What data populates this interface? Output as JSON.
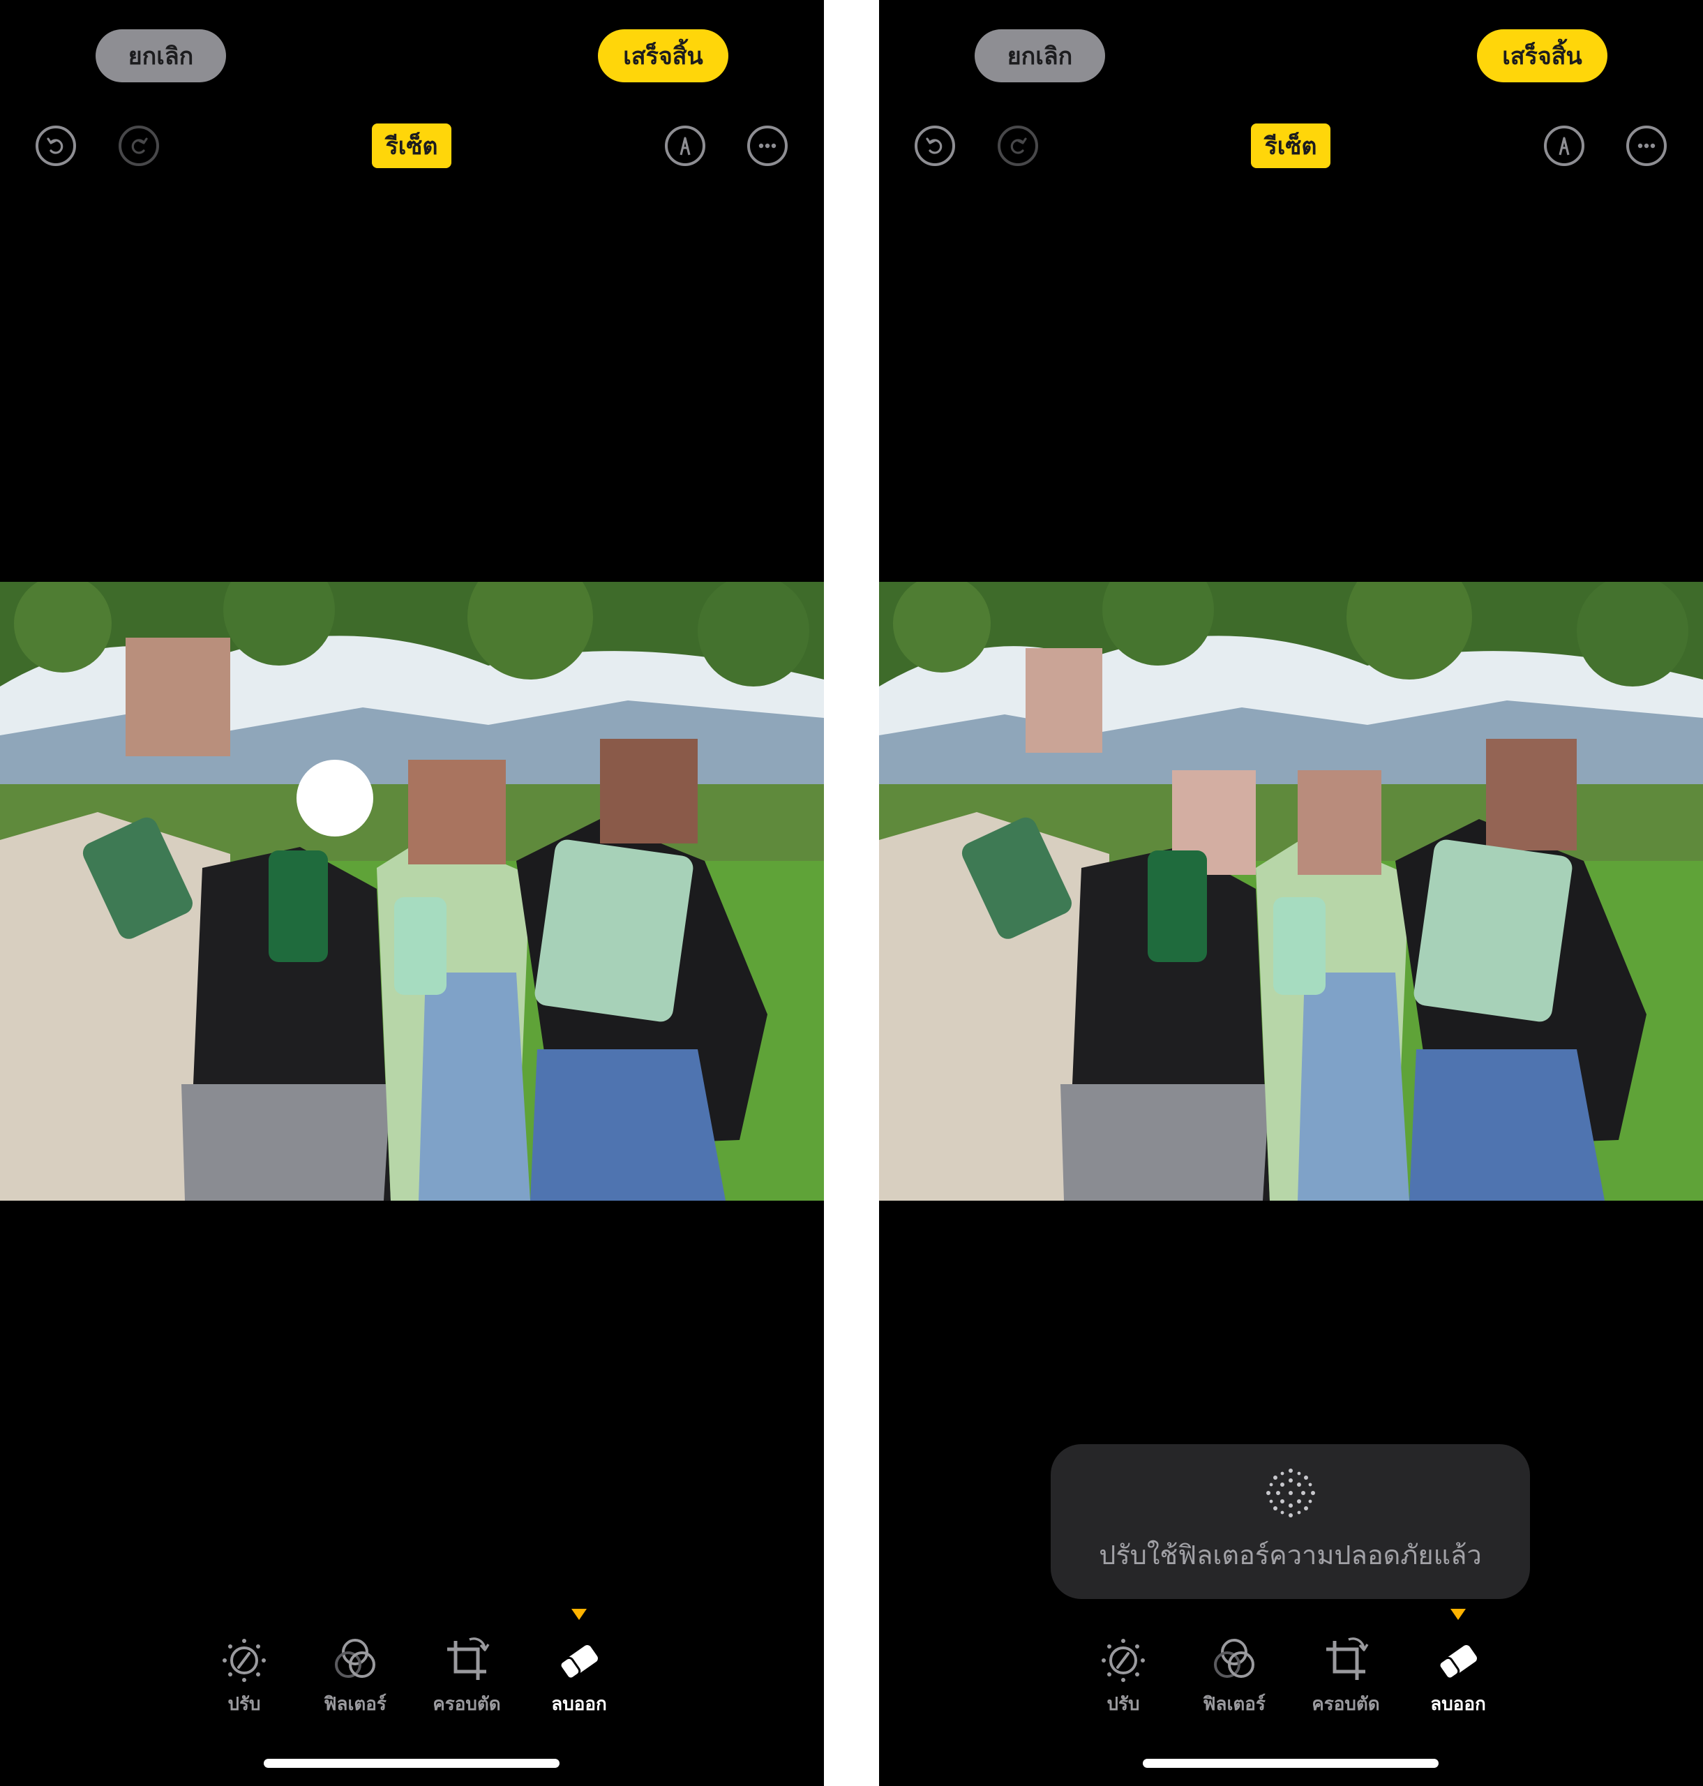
{
  "left": {
    "cancel_label": "ยกเลิก",
    "done_label": "เสร็จสิ้น",
    "reset_label": "รีเซ็ต",
    "tools": {
      "adjust": "ปรับ",
      "filters": "ฟิลเตอร์",
      "crop": "ครอบตัด",
      "erase": "ลบออก"
    },
    "active_tool": "erase"
  },
  "right": {
    "cancel_label": "ยกเลิก",
    "done_label": "เสร็จสิ้น",
    "reset_label": "รีเซ็ต",
    "tools": {
      "adjust": "ปรับ",
      "filters": "ฟิลเตอร์",
      "crop": "ครอบตัด",
      "erase": "ลบออก"
    },
    "active_tool": "erase",
    "toast": {
      "icon": "safety-filter-icon",
      "message": "ปรับใช้ฟิลเตอร์ความปลอดภัยแล้ว"
    }
  },
  "icons": [
    "undo-icon",
    "redo-icon",
    "markup-pen-icon",
    "more-ellipsis-icon",
    "adjust-dial-icon",
    "filters-circles-icon",
    "crop-icon",
    "eraser-icon"
  ],
  "colors": {
    "accent": "#ffd60a",
    "background": "#000000",
    "secondary_button": "#8e8e93"
  }
}
